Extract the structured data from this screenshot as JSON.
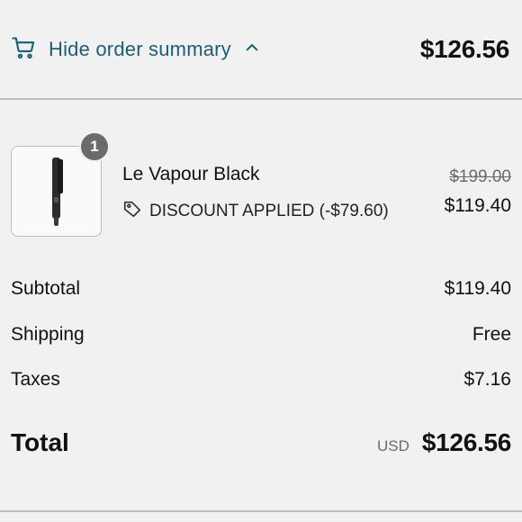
{
  "header": {
    "toggle_label": "Hide order summary",
    "total": "$126.56",
    "accent_color": "#1b5e78"
  },
  "product": {
    "name": "Le Vapour Black",
    "quantity": "1",
    "discount_label": "DISCOUNT APPLIED (-$79.60)",
    "original_price": "$199.00",
    "price": "$119.40",
    "image_icon": "flat-iron-icon"
  },
  "summary": {
    "subtotal_label": "Subtotal",
    "subtotal_value": "$119.40",
    "shipping_label": "Shipping",
    "shipping_value": "Free",
    "taxes_label": "Taxes",
    "taxes_value": "$7.16",
    "total_label": "Total",
    "currency": "USD",
    "total_value": "$126.56"
  }
}
